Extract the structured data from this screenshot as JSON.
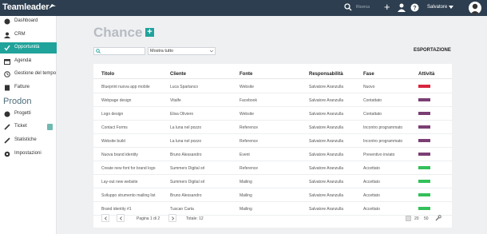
{
  "topbar": {
    "logo": "Teamleader",
    "search_placeholder": "Ricerca",
    "plus": "+",
    "user": "Salvatore"
  },
  "sidebar": {
    "items": [
      {
        "label": "Dashboard",
        "icon": "dashboard-icon"
      },
      {
        "label": "CRM",
        "icon": "user-icon"
      },
      {
        "label": "Opportunità",
        "icon": "check-icon",
        "active": true
      },
      {
        "label": "Agenda",
        "icon": "calendar-icon",
        "badge": "1"
      },
      {
        "label": "Gestione del tempo",
        "icon": "clock-icon"
      },
      {
        "label": "Fatture",
        "icon": "invoice-icon"
      }
    ],
    "section": "Prodon",
    "items2": [
      {
        "label": "Progetti",
        "icon": "projects-icon"
      },
      {
        "label": "Ticket",
        "icon": "ticket-icon"
      },
      {
        "label": "Statistiche",
        "icon": "stats-icon"
      },
      {
        "label": "Impostazioni",
        "icon": "gear-icon"
      }
    ]
  },
  "main": {
    "title": "Chance",
    "add": "+",
    "filter": "Mostra tutto",
    "export": "ESPORTAZIONE"
  },
  "table": {
    "headers": [
      "Titolo",
      "Cliente",
      "Fonte",
      "Responsabilità",
      "Fase",
      "Attività"
    ],
    "rows": [
      {
        "titolo": "Blueprint nuova app mobile",
        "cliente": "Luca Spartanco",
        "fonte": "Website",
        "resp": "Salvatore Aranzulla",
        "fase": "Nuovo",
        "color": "#d9263f"
      },
      {
        "titolo": "Webpage design",
        "cliente": "Vitalfe",
        "fonte": "Facebook",
        "resp": "Salvatore Aranzulla",
        "fase": "Contattato",
        "color": "#7b3f73"
      },
      {
        "titolo": "Logo design",
        "cliente": "Elisa Oliviero",
        "fonte": "Website",
        "resp": "Salvatore Aranzulla",
        "fase": "Contattato",
        "color": "#7b3f73"
      },
      {
        "titolo": "Contact Forms",
        "cliente": "La luna nel pozzo",
        "fonte": "Reference",
        "resp": "Salvatore Aranzulla",
        "fase": "Incontro programmato",
        "color": "#7b3f73"
      },
      {
        "titolo": "Website build",
        "cliente": "La luna nel pozzo",
        "fonte": "Reference",
        "resp": "Salvatore Aranzulla",
        "fase": "Incontro programmato",
        "color": "#7b3f73"
      },
      {
        "titolo": "Nuova brand identity",
        "cliente": "Bruno Alessandro",
        "fonte": "Event",
        "resp": "Salvatore Aranzulla",
        "fase": "Preventivo inviato",
        "color": "#7b3f73"
      },
      {
        "titolo": "Create new font for brand logo",
        "cliente": "Summers Digital srl",
        "fonte": "Reference",
        "resp": "Salvatore Aranzulla",
        "fase": "Accettato",
        "color": "#33c05a"
      },
      {
        "titolo": "Lay-out new website",
        "cliente": "Summers Digital srl",
        "fonte": "Mailing",
        "resp": "Salvatore Aranzulla",
        "fase": "Accettato",
        "color": "#33c05a"
      },
      {
        "titolo": "Sviluppo strumento mailing list",
        "cliente": "Bruno Alessandro",
        "fonte": "Mailing",
        "resp": "Salvatore Aranzulla",
        "fase": "Accettato",
        "color": "#33c05a"
      },
      {
        "titolo": "Brand identity #1",
        "cliente": "Tuscan Carta",
        "fonte": "Mailing",
        "resp": "Salvatore Aranzulla",
        "fase": "Accettato",
        "color": "#33c05a"
      }
    ]
  },
  "pager": {
    "page_label": "Pagina 1 di 2",
    "total": "Totale: 12",
    "size_20": "20",
    "size_50": "50"
  }
}
